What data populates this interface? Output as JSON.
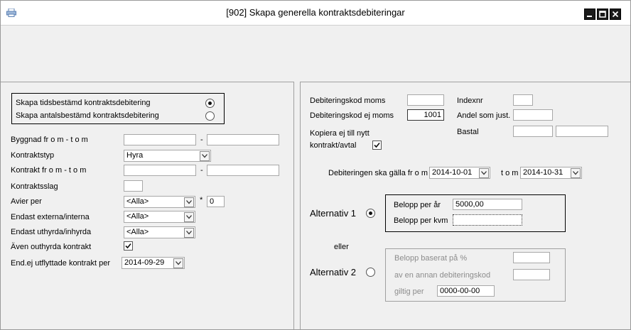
{
  "window": {
    "title": "[902]  Skapa generella kontraktsdebiteringar"
  },
  "left": {
    "debit_type": {
      "option1": "Skapa tidsbestämd kontraktsdebitering",
      "option2": "Skapa antalsbestämd kontraktsdebitering",
      "selected": 1
    },
    "byggnad_label": "Byggnad fr o m  - t o m",
    "kontraktstyp_label": "Kontraktstyp",
    "kontraktstyp_value": "Hyra",
    "kontrakt_label": "Kontrakt fr o m  - t o m",
    "kontraktsslag_label": "Kontraktsslag",
    "avier_label": "Avier per",
    "avier_value": "<Alla>",
    "avier_multiplier": "*",
    "avier_number": "0",
    "externa_label": "Endast externa/interna",
    "externa_value": "<Alla>",
    "uthyrda_label": "Endast uthyrda/inhyrda",
    "uthyrda_value": "<Alla>",
    "outhyrda_label": "Även outhyrda kontrakt",
    "outhyrda_checked": true,
    "utflyttade_label": "End.ej utflyttade kontrakt per",
    "utflyttade_value": "2014-09-29",
    "dash": "-"
  },
  "right": {
    "debkod_moms_label": "Debiteringskod moms",
    "debkod_ejmoms_label": "Debiteringskod ej moms",
    "debkod_ejmoms_value": "1001",
    "kopiera_label_line1": "Kopiera ej till nytt",
    "kopiera_label_line2": "kontrakt/avtal",
    "kopiera_checked": true,
    "indexnr_label": "Indexnr",
    "andel_label": "Andel som just.",
    "bastal_label": "Bastal",
    "period_label": "Debiteringen ska gälla fr o m",
    "period_from": "2014-10-01",
    "period_tom_label": "t o m",
    "period_to": "2014-10-31",
    "alt1_label": "Alternativ 1",
    "alt1_selected": true,
    "belopp_ar_label": "Belopp per år",
    "belopp_ar_value": "5000,00",
    "belopp_kvm_label": "Belopp per kvm",
    "eller_label": "eller",
    "alt2_label": "Alternativ 2",
    "alt2_selected": false,
    "belopp_procent_label": "Belopp baserat på %",
    "annan_debkod_label": "av en annan debiteringskod",
    "giltig_label": "giltig per",
    "giltig_value": "0000-00-00"
  },
  "colors": {
    "panel_bg": "#f0f0f0",
    "border_dark": "#000000",
    "border_grey": "#a0a0a0"
  },
  "icons": {
    "app": "printer-icon",
    "dropdown": "chevron-down-icon"
  }
}
